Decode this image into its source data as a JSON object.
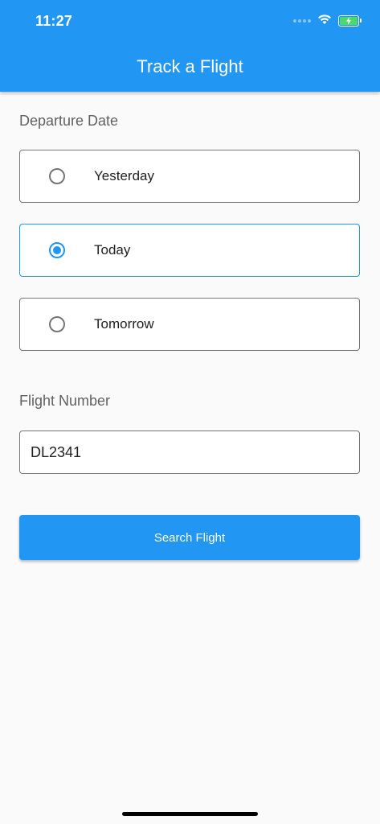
{
  "status_bar": {
    "time": "11:27",
    "icons": [
      "signal-icon",
      "wifi-icon",
      "battery-charging-icon"
    ]
  },
  "app_bar": {
    "title": "Track a Flight"
  },
  "departure": {
    "label": "Departure Date",
    "options": [
      {
        "label": "Yesterday",
        "selected": false
      },
      {
        "label": "Today",
        "selected": true
      },
      {
        "label": "Tomorrow",
        "selected": false
      }
    ]
  },
  "flight": {
    "label": "Flight Number",
    "value": "DL2341",
    "placeholder": ""
  },
  "search_button": {
    "label": "Search Flight"
  },
  "colors": {
    "primary": "#2196f3",
    "background": "#fafafa",
    "border": "#757575",
    "battery": "#4cd964"
  }
}
